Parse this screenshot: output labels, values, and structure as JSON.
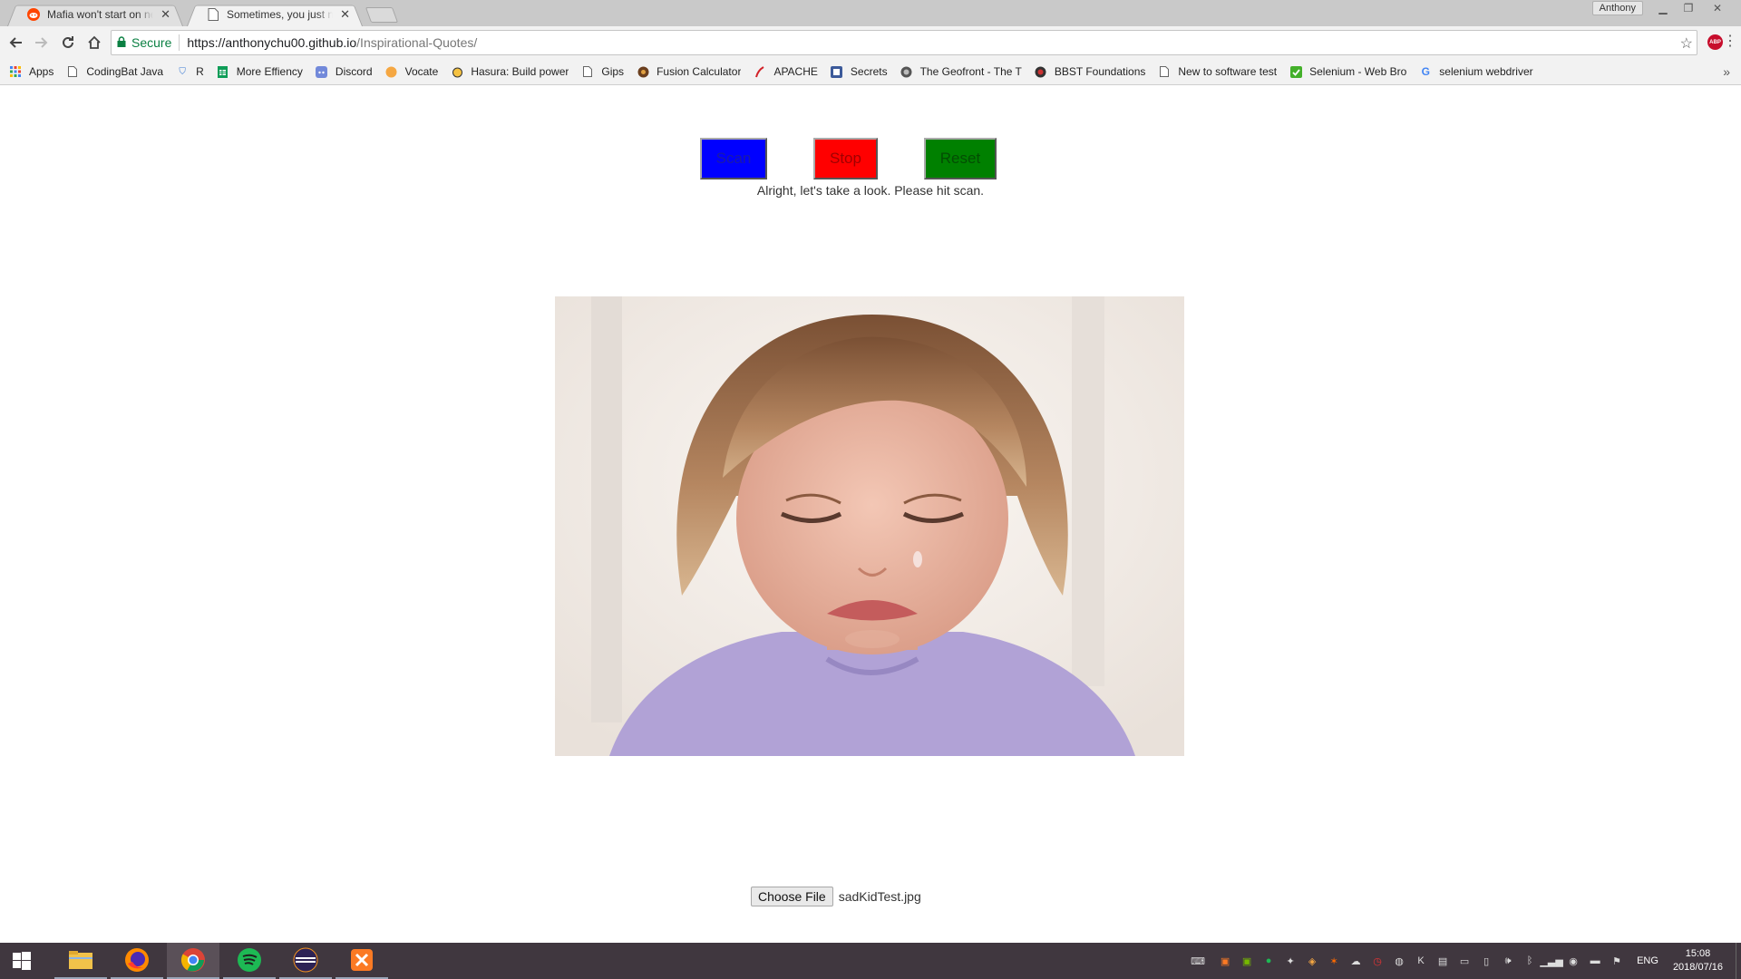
{
  "browser": {
    "tabs": [
      {
        "title": "Mafia won't start on new",
        "favicon": "reddit-icon",
        "active": false
      },
      {
        "title": "Sometimes, you just nee",
        "favicon": "page-icon",
        "active": true
      }
    ],
    "profile_name": "Anthony",
    "secure_label": "Secure",
    "url_main": "https://anthonychu00.github.io",
    "url_path": "/Inspirational-Quotes/",
    "bookmarks": [
      {
        "label": "Apps",
        "icon": "apps-grid-icon"
      },
      {
        "label": "CodingBat Java",
        "icon": "page-icon"
      },
      {
        "label": "R",
        "icon": "shield-icon"
      },
      {
        "label": "More Effiency",
        "icon": "sheets-icon"
      },
      {
        "label": "Discord",
        "icon": "discord-icon"
      },
      {
        "label": "Vocate",
        "icon": "vocate-icon"
      },
      {
        "label": "Hasura: Build power",
        "icon": "hasura-icon"
      },
      {
        "label": "Gips",
        "icon": "page-icon"
      },
      {
        "label": "Fusion Calculator",
        "icon": "fusion-icon"
      },
      {
        "label": "APACHE",
        "icon": "feather-icon"
      },
      {
        "label": "Secrets",
        "icon": "secrets-icon"
      },
      {
        "label": "The Geofront - The T",
        "icon": "geofront-icon"
      },
      {
        "label": "BBST Foundations",
        "icon": "bbst-icon"
      },
      {
        "label": "New to software test",
        "icon": "page-icon"
      },
      {
        "label": "Selenium - Web Bro",
        "icon": "selenium-icon"
      },
      {
        "label": "selenium webdriver",
        "icon": "google-icon"
      }
    ]
  },
  "page": {
    "buttons": {
      "scan": "Scan",
      "stop": "Stop",
      "reset": "Reset"
    },
    "status_message": "Alright, let's take a look. Please hit scan.",
    "file_input": {
      "button_label": "Choose File",
      "file_name": "sadKidTest.jpg"
    },
    "image": {
      "subject": "photo of a crying toddler in a lavender sweater"
    }
  },
  "taskbar": {
    "apps": [
      "file-explorer-icon",
      "firefox-icon",
      "chrome-icon",
      "spotify-icon",
      "eclipse-icon",
      "xampp-icon"
    ],
    "active_app": "chrome-icon",
    "language": "ENG",
    "time": "15:08",
    "date": "2018/07/16"
  },
  "colors": {
    "scan": "#0000ff",
    "stop": "#ff0000",
    "reset": "#008000",
    "taskbar": "#40373f"
  }
}
